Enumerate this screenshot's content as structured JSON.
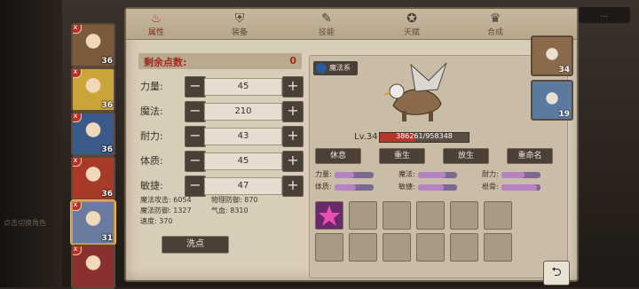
{
  "top_badge": "...",
  "tabs": [
    {
      "label": "属性",
      "icon": "flame-icon"
    },
    {
      "label": "装备",
      "icon": "armor-icon"
    },
    {
      "label": "技能",
      "icon": "book-icon"
    },
    {
      "label": "天赋",
      "icon": "star-icon"
    },
    {
      "label": "合成",
      "icon": "crown-icon"
    }
  ],
  "remaining": {
    "label": "剩余点数:",
    "value": "0"
  },
  "attributes": [
    {
      "name": "力量:",
      "value": "45"
    },
    {
      "name": "魔法:",
      "value": "210"
    },
    {
      "name": "耐力:",
      "value": "43"
    },
    {
      "name": "体质:",
      "value": "45"
    },
    {
      "name": "敏捷:",
      "value": "47"
    }
  ],
  "stats": [
    [
      "魔法攻击: 6054",
      "物理防御: 870"
    ],
    [
      "魔法防御: 1327",
      "气血: 8310"
    ],
    [
      "速度: 370",
      ""
    ]
  ],
  "wash_button": "洗点",
  "pet": {
    "ability_label": "魔法系",
    "level": "Lv.34",
    "hp_text": "386261/958348",
    "hp_ratio": 0.4,
    "buttons": [
      "休息",
      "重生",
      "放生",
      "重命名"
    ],
    "pstats": [
      {
        "label": "力量:",
        "ratio": 0.5
      },
      {
        "label": "魔法:",
        "ratio": 0.7
      },
      {
        "label": "耐力:",
        "ratio": 0.6
      },
      {
        "label": "体质:",
        "ratio": 0.55
      },
      {
        "label": "敏捷:",
        "ratio": 0.65
      },
      {
        "label": "根骨:",
        "ratio": 0.9
      }
    ]
  },
  "portraits": [
    {
      "level": "36",
      "color": "#7a5a3a"
    },
    {
      "level": "36",
      "color": "#caa53a"
    },
    {
      "level": "36",
      "color": "#3a5a8a"
    },
    {
      "level": "36",
      "color": "#a83a2a"
    },
    {
      "level": "31",
      "color": "#6a7aa0"
    },
    {
      "level": "",
      "color": "#8a3030"
    }
  ],
  "right_portraits": [
    {
      "level": "34",
      "color": "#8a6a4a"
    },
    {
      "level": "19",
      "color": "#5a7aa0"
    }
  ],
  "side_note": "点击切换角色"
}
